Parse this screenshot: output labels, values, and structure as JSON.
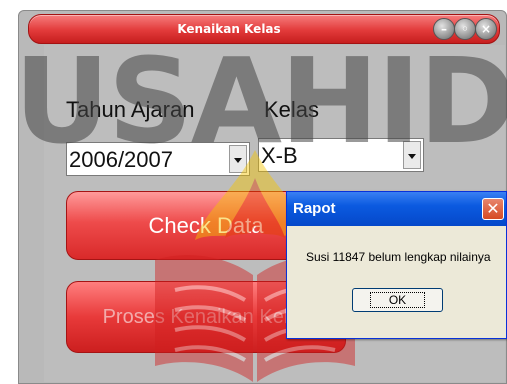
{
  "window": {
    "title": "Kenaikan Kelas",
    "buttons": [
      "minimize-icon",
      "restore-icon",
      "close-icon"
    ]
  },
  "form": {
    "tahun_label": "Tahun Ajaran",
    "tahun_value": "2006/2007",
    "kelas_label": "Kelas",
    "kelas_value": "X-B",
    "check_button": "Check Data",
    "proses_button": "Proses Kenaikan Kelas"
  },
  "watermark": {
    "text": "USAHID"
  },
  "dialog": {
    "title": "Rapot",
    "message": "Susi 11847 belum lengkap nilainya",
    "ok_label": "OK"
  },
  "colors": {
    "titlebar": "#e23a3a",
    "button": "#ee4b4b",
    "dialog_title": "#0b5ae0",
    "background": "#bdbdbd"
  }
}
